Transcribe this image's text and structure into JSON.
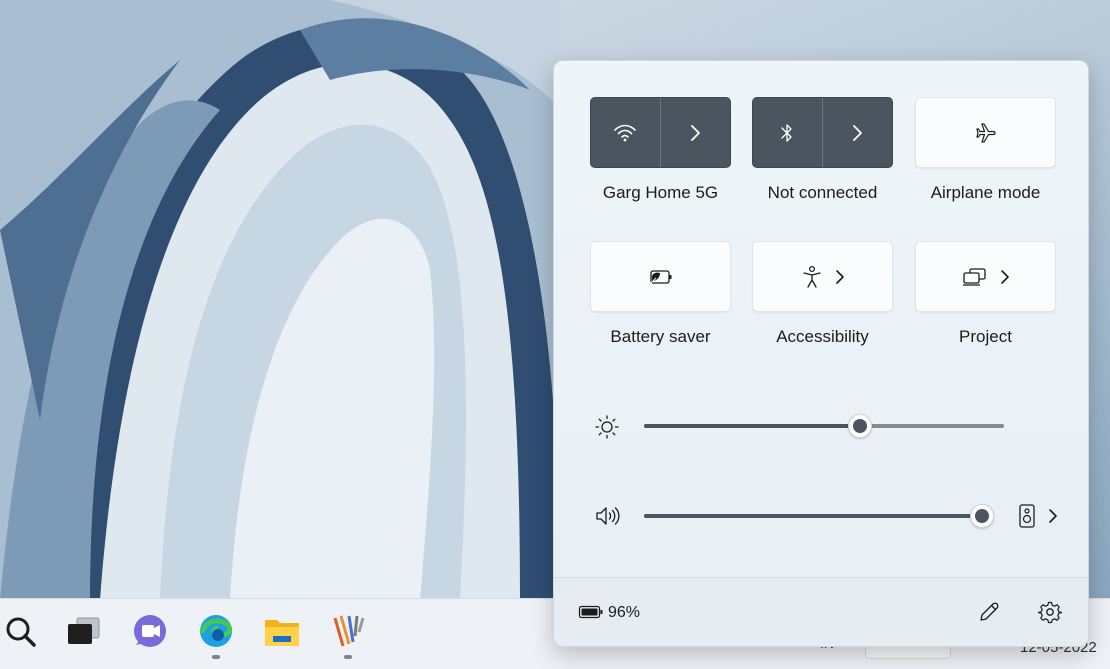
{
  "quick_settings": {
    "tiles": [
      {
        "label": "Garg Home 5G",
        "icon": "wifi-icon",
        "state": "on"
      },
      {
        "label": "Not connected",
        "icon": "bluetooth-icon",
        "state": "on"
      },
      {
        "label": "Airplane mode",
        "icon": "airplane-icon",
        "state": "off"
      },
      {
        "label": "Battery saver",
        "icon": "battery-saver-icon",
        "state": "off"
      },
      {
        "label": "Accessibility",
        "icon": "accessibility-icon",
        "state": "off"
      },
      {
        "label": "Project",
        "icon": "project-icon",
        "state": "off"
      }
    ],
    "brightness": {
      "level_percent": 60,
      "icon": "brightness-icon"
    },
    "volume": {
      "level_percent": 97,
      "icon": "speaker-icon",
      "output_icon": "speaker-device-icon"
    },
    "footer": {
      "battery_label": "96%",
      "battery_icon": "battery-icon",
      "edit_icon": "pencil-icon",
      "settings_icon": "gear-icon"
    }
  },
  "taskbar": {
    "apps": [
      "search-icon",
      "task-view-icon",
      "chat-icon",
      "edge-icon",
      "file-explorer-icon",
      "app-icon"
    ],
    "tray_text": "IN",
    "clock_fragment": "12-05-2022"
  },
  "colors": {
    "active_tile": "#4a5560",
    "panel_bg": "#eef3f7",
    "accent_thumb": "#4a5560"
  }
}
